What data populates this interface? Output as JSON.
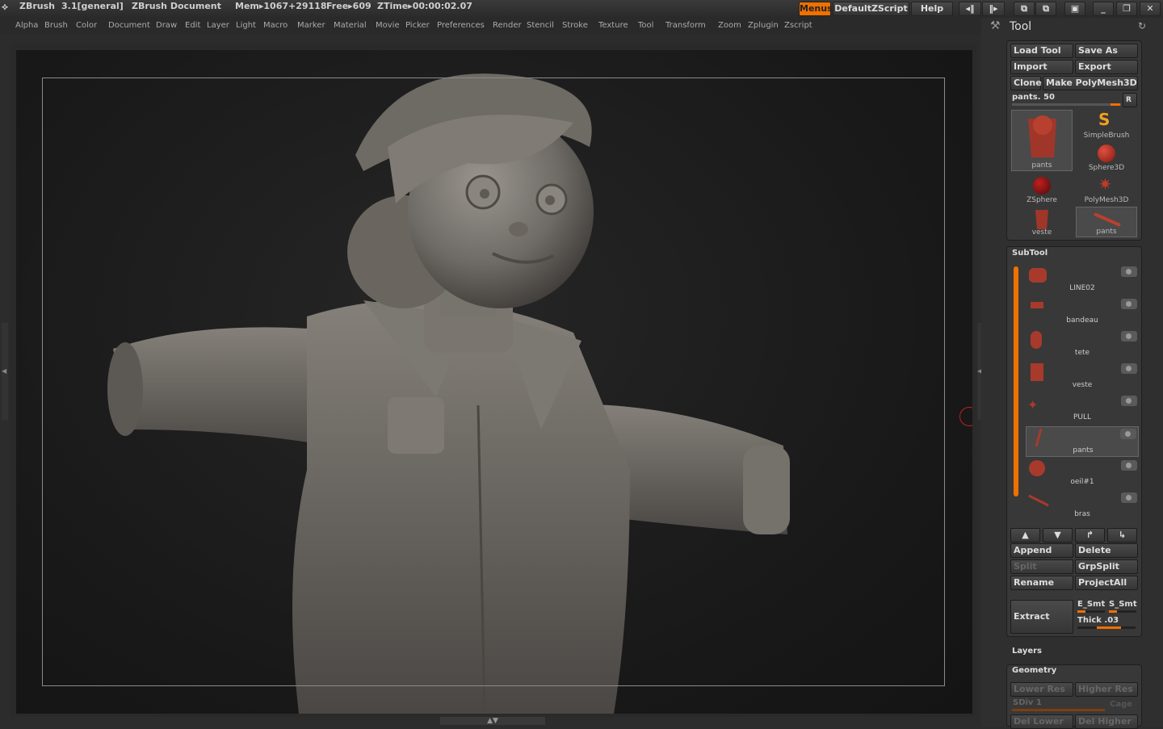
{
  "title": {
    "app": "ZBrush",
    "version": "3.1[general]",
    "document": "ZBrush Document",
    "mem": "Mem▸1067+29118",
    "free": "Free▸609",
    "ztime": "ZTime▸00:00:02.07"
  },
  "topbuttons": {
    "menus": "Menus",
    "script": "DefaultZScript",
    "help": "Help"
  },
  "menus": [
    "Alpha",
    "Brush",
    "Color",
    "Document",
    "Draw",
    "Edit",
    "Layer",
    "Light",
    "Macro",
    "Marker",
    "Material",
    "Movie",
    "Picker",
    "Preferences",
    "Render",
    "Stencil",
    "Stroke",
    "Texture",
    "Tool",
    "Transform",
    "Zoom",
    "Zplugin",
    "Zscript"
  ],
  "tool": {
    "title": "Tool",
    "load": "Load Tool",
    "save": "Save As",
    "import": "Import",
    "export": "Export",
    "clone": "Clone",
    "make": "Make PolyMesh3D",
    "current": "pants. 50",
    "r": "R",
    "slots": [
      "pants",
      "SimpleBrush",
      "Sphere3D",
      "ZSphere",
      "PolyMesh3D",
      "veste",
      "pants"
    ]
  },
  "subtool": {
    "title": "SubTool",
    "items": [
      "LINE02",
      "bandeau",
      "tete",
      "veste",
      "PULL",
      "pants",
      "oeil#1",
      "bras"
    ],
    "append": "Append",
    "delete": "Delete",
    "split": "Split",
    "grpsplit": "GrpSplit",
    "rename": "Rename",
    "projectall": "ProjectAll",
    "extract": "Extract",
    "esmt": "E_Smt",
    "ssmt": "S_Smt",
    "thick": "Thick .03"
  },
  "layers": {
    "title": "Layers"
  },
  "geometry": {
    "title": "Geometry",
    "lower": "Lower Res",
    "higher": "Higher Res",
    "sdiv": "SDiv 1",
    "cage": "Cage",
    "dellower": "Del Lower",
    "delhigher": "Del Higher"
  },
  "colors": {
    "accent": "#f07000",
    "model": "#8a8580"
  }
}
